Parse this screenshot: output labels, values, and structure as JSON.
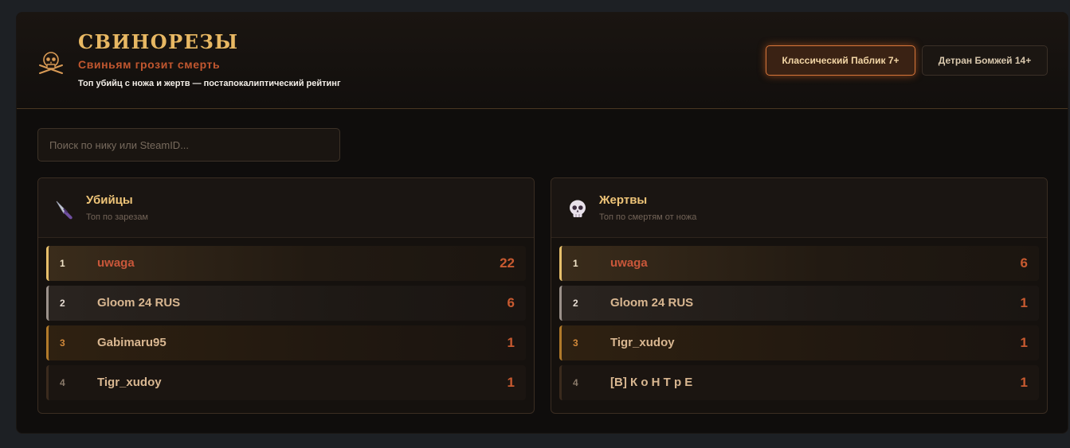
{
  "header": {
    "title": "СВИНОРЕЗЫ",
    "subtitle": "Свиньям грозит смерть",
    "tagline": "Топ убийц с ножа и жертв — постапокалиптический рейтинг",
    "logo_icon": "skull-crossbones-icon"
  },
  "tabs": [
    {
      "label": "Классический Паблик 7+",
      "active": true
    },
    {
      "label": "Детран Бомжей 14+",
      "active": false
    }
  ],
  "search": {
    "placeholder": "Поиск по нику или SteamID...",
    "value": ""
  },
  "killers": {
    "icon": "knife-icon",
    "title": "Убийцы",
    "subtitle": "Топ по зарезам",
    "rows": [
      {
        "rank": "1",
        "name": "uwaga",
        "count": "22"
      },
      {
        "rank": "2",
        "name": "Gloom 24 RUS",
        "count": "6"
      },
      {
        "rank": "3",
        "name": "Gabimaru95",
        "count": "1"
      },
      {
        "rank": "4",
        "name": "Tigr_xudoy",
        "count": "1"
      }
    ]
  },
  "victims": {
    "icon": "skull-icon",
    "title": "Жертвы",
    "subtitle": "Топ по смертям от ножа",
    "rows": [
      {
        "rank": "1",
        "name": "uwaga",
        "count": "6"
      },
      {
        "rank": "2",
        "name": "Gloom 24 RUS",
        "count": "1"
      },
      {
        "rank": "3",
        "name": "Tigr_xudoy",
        "count": "1"
      },
      {
        "rank": "4",
        "name": "[B] К о Н Т р Е",
        "count": "1"
      }
    ]
  },
  "colors": {
    "accent_gold": "#e8b863",
    "accent_red": "#c85a30",
    "active_tab_border": "#d7763a",
    "background": "#0f0d0c"
  }
}
